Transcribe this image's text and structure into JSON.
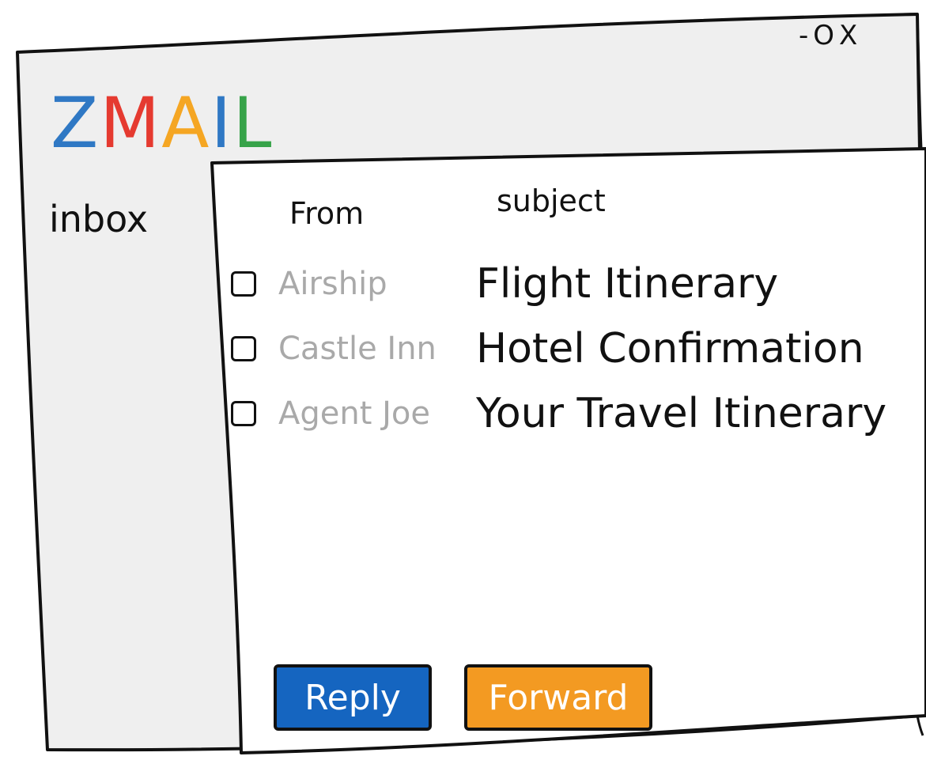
{
  "window": {
    "controls": {
      "minimize": "-",
      "maximize": "O",
      "close": "X"
    }
  },
  "logo": {
    "letters": [
      {
        "char": "Z",
        "color": "#2f78c4"
      },
      {
        "char": "M",
        "color": "#e53a30"
      },
      {
        "char": "A",
        "color": "#f5a623"
      },
      {
        "char": "I",
        "color": "#2f78c4"
      },
      {
        "char": "L",
        "color": "#37a349"
      }
    ]
  },
  "sidebar": {
    "inbox_label": "inbox"
  },
  "inbox": {
    "columns": {
      "from": "From",
      "subject": "subject"
    },
    "rows": [
      {
        "from": "Airship",
        "subject": "Flight Itinerary"
      },
      {
        "from": "Castle Inn",
        "subject": "Hotel Confirmation"
      },
      {
        "from": "Agent Joe",
        "subject": "Your Travel Itinerary"
      }
    ]
  },
  "actions": {
    "reply_label": "Reply",
    "forward_label": "Forward",
    "reply_color": "#1565c0",
    "forward_color": "#f39a22"
  }
}
